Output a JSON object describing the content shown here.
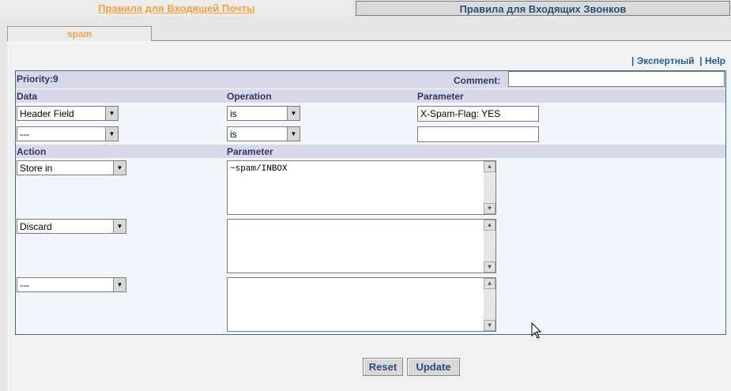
{
  "tabs": {
    "incoming_mail": "Правила для Входящей Почты",
    "incoming_calls": "Правила для Входящих Звонков"
  },
  "rule_tab": "spam",
  "links": {
    "expert": "Экспертный",
    "help": "Help",
    "separator": "|"
  },
  "rule": {
    "priority": "Priority:9",
    "comment_label": "Comment:",
    "comment_value": ""
  },
  "conditions": {
    "headers": {
      "data": "Data",
      "operation": "Operation",
      "parameter": "Parameter"
    },
    "rows": [
      {
        "data": "Header Field",
        "operation": "is",
        "parameter": "X-Spam-Flag: YES"
      },
      {
        "data": "---",
        "operation": "is",
        "parameter": ""
      }
    ]
  },
  "actions": {
    "headers": {
      "action": "Action",
      "parameter": "Parameter"
    },
    "rows": [
      {
        "action": "Store in",
        "parameter": "~spam/INBOX"
      },
      {
        "action": "Discard",
        "parameter": ""
      },
      {
        "action": "---",
        "parameter": ""
      }
    ]
  },
  "buttons": {
    "reset": "Reset",
    "update": "Update"
  },
  "icons": {
    "dropdown": "triangle-down",
    "scroll_up": "triangle-up",
    "scroll_down": "triangle-down"
  },
  "colors": {
    "accent_orange": "#f7a23c",
    "link_blue": "#2a5a8a",
    "header_bar": "#d8d8e8",
    "box_border": "#3c6c9c"
  }
}
